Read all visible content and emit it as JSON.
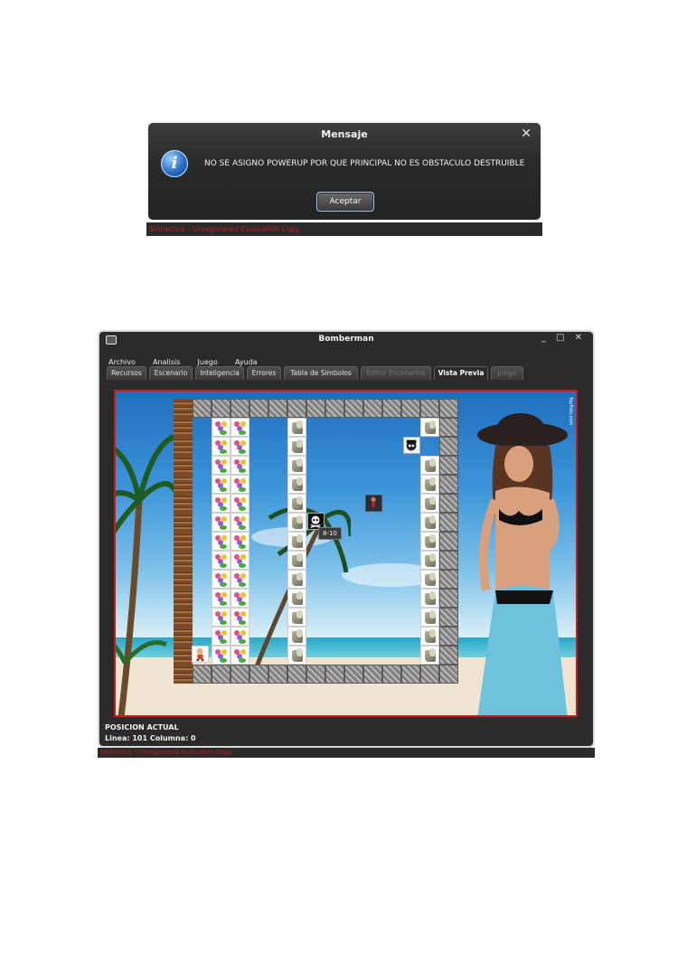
{
  "dialog": {
    "title": "Mensaje",
    "message": "NO SE ASIGNO POWERUP POR QUE PRINCIPAL NO ES OBSTACULO DESTRUIBLE",
    "ok_label": "Aceptar",
    "icon": "info-icon",
    "close_icon": "close-icon",
    "close_glyph": "✕",
    "info_glyph": "i"
  },
  "dialog_watermark": "Sintactica - Unregistered Evaluation Copy",
  "window": {
    "title": "Bomberman",
    "controls_glyph": "_ □ ✕",
    "menu": [
      "Archivo",
      "Analisis",
      "Juego",
      "Ayuda"
    ],
    "tabs": [
      {
        "label": "Recursos",
        "state": "normal"
      },
      {
        "label": "Escenario",
        "state": "normal"
      },
      {
        "label": "Inteligencia",
        "state": "normal"
      },
      {
        "label": "Errores",
        "state": "normal"
      },
      {
        "label": "Tabla de Simbolos",
        "state": "normal"
      },
      {
        "label": "Editor Escenarios",
        "state": "disabled"
      },
      {
        "label": "Vista Previa",
        "state": "active"
      },
      {
        "label": "Juego",
        "state": "disabled"
      }
    ],
    "tooltip": "8-10",
    "credit": "TopFoto.com",
    "status_title": "POSICION ACTUAL",
    "status_position": "Linea: 101  Columna: 0",
    "watermark": "Sintactica - Unregistered Evaluation Copy",
    "border_color": "#d01818"
  }
}
